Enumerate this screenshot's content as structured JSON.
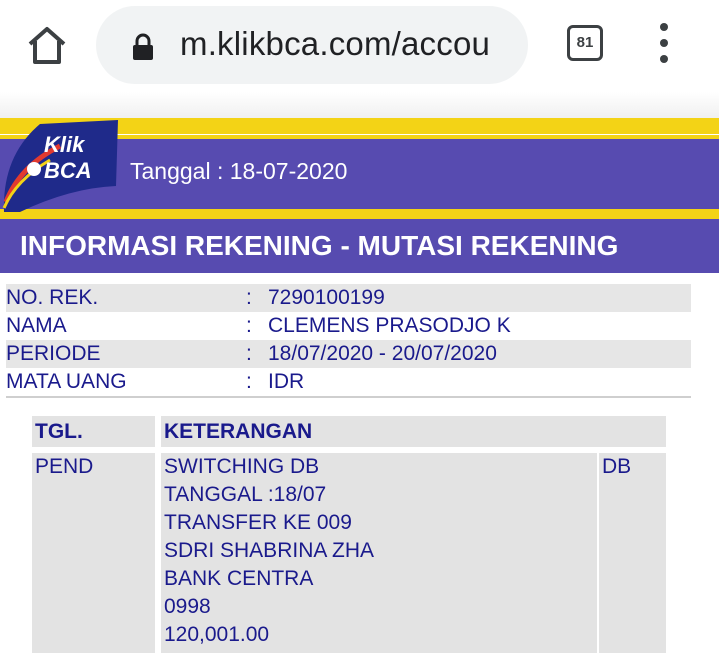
{
  "browser": {
    "url": "m.klikbca.com/accou",
    "tab_count": "81"
  },
  "header": {
    "logo_text_top": "Klik",
    "logo_text_bottom": "BCA",
    "date_label": "Tanggal : ",
    "date_value": "18-07-2020",
    "brand_blue": "#574bb0",
    "brand_yellow": "#f3d316"
  },
  "title": "INFORMASI REKENING - MUTASI REKENING",
  "account_info": [
    {
      "label": "NO. REK.",
      "value": "7290100199"
    },
    {
      "label": "NAMA",
      "value": "CLEMENS PRASODJO K"
    },
    {
      "label": "PERIODE",
      "value": "18/07/2020 - 20/07/2020"
    },
    {
      "label": "MATA UANG",
      "value": "IDR"
    }
  ],
  "transactions": {
    "headers": {
      "tgl": "TGL.",
      "keterangan": "KETERANGAN"
    },
    "rows": [
      {
        "tgl": "PEND",
        "keterangan": [
          "SWITCHING DB",
          "TANGGAL :18/07",
          "TRANSFER KE 009",
          "SDRI SHABRINA ZHA",
          "BANK CENTRA",
          "0998",
          "120,001.00"
        ],
        "type": "DB"
      }
    ]
  }
}
